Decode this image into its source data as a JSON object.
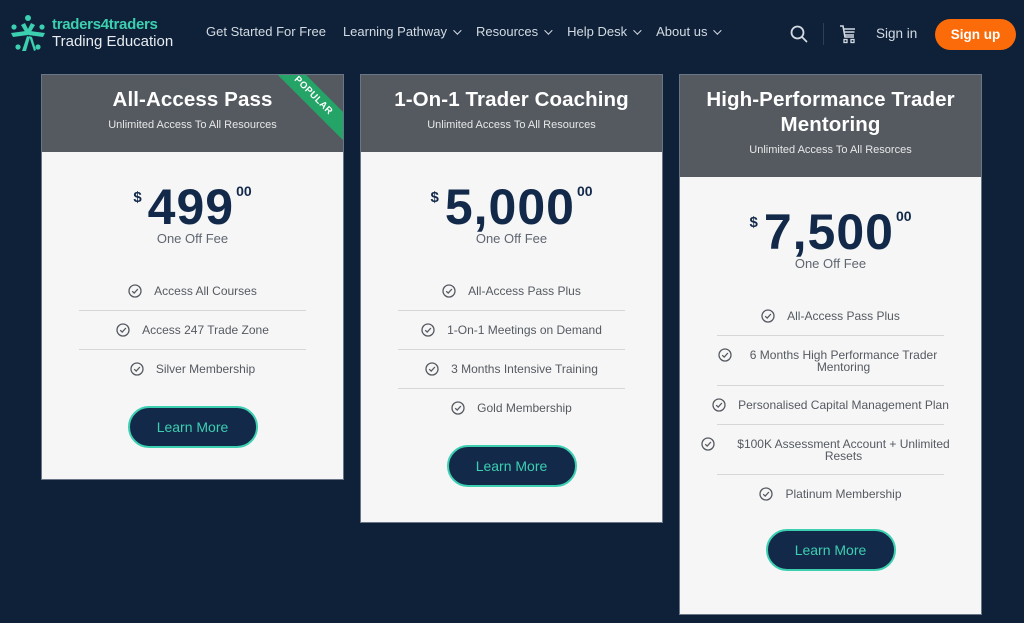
{
  "header": {
    "logo": {
      "brand": "traders4traders",
      "subtitle": "Trading Education",
      "icon": "people-star-logo-icon"
    },
    "nav": [
      {
        "label": "Get Started For Free",
        "has_dropdown": false
      },
      {
        "label": "Learning Pathway",
        "has_dropdown": true
      },
      {
        "label": "Resources",
        "has_dropdown": true
      },
      {
        "label": "Help Desk",
        "has_dropdown": true
      },
      {
        "label": "About us",
        "has_dropdown": true
      }
    ],
    "icons": {
      "search": "search-icon",
      "cart": "cart-icon"
    },
    "sign_in": "Sign in",
    "sign_up": "Sign up"
  },
  "colors": {
    "background": "#0e2139",
    "accent_teal": "#3ccfb0",
    "signup_orange": "#fb6b0a",
    "card_header": "#555a61",
    "price_navy": "#13294a",
    "popular_green": "#24a567"
  },
  "plans": [
    {
      "title": "All-Access Pass",
      "subtitle": "Unlimited Access To All Resources",
      "badge": "POPULAR",
      "currency": "$",
      "amount": "499",
      "cents": "00",
      "fee_label": "One Off Fee",
      "features": [
        "Access All Courses",
        "Access 247 Trade Zone",
        "Silver Membership"
      ],
      "button": "Learn More"
    },
    {
      "title": "1-On-1 Trader Coaching",
      "subtitle": "Unlimited Access To All Resources",
      "currency": "$",
      "amount": "5,000",
      "cents": "00",
      "fee_label": "One Off Fee",
      "features": [
        "All-Access Pass Plus",
        "1-On-1 Meetings on Demand",
        "3 Months Intensive Training",
        "Gold Membership"
      ],
      "button": "Learn More"
    },
    {
      "title": "High-Performance Trader Mentoring",
      "subtitle": "Unlimited Access To All Resorces",
      "currency": "$",
      "amount": "7,500",
      "cents": "00",
      "fee_label": "One Off Fee",
      "features": [
        "All-Access Pass Plus",
        "6 Months High Performance Trader Mentoring",
        "Personalised Capital Management Plan",
        "$100K Assessment Account + Unlimited Resets",
        "Platinum Membership"
      ],
      "button": "Learn More"
    }
  ]
}
